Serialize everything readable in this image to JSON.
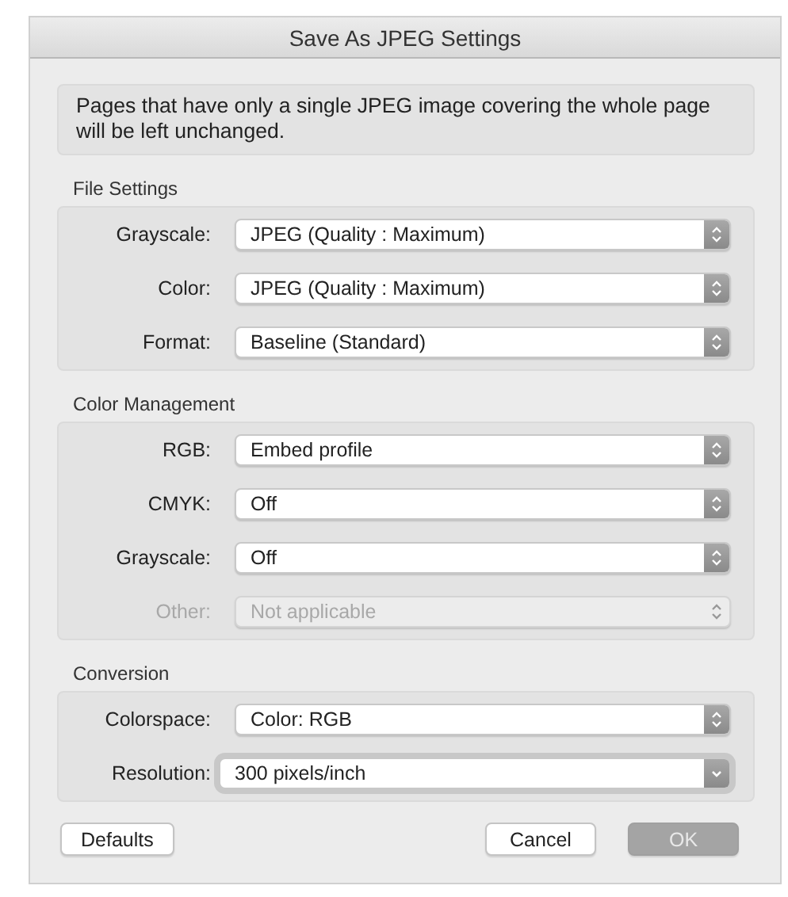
{
  "window": {
    "title": "Save As JPEG Settings"
  },
  "notice": "Pages that have only a single JPEG image covering the whole page will be left unchanged.",
  "sections": [
    {
      "title": "File Settings",
      "rows": [
        {
          "label": "Grayscale:",
          "value": "JPEG (Quality : Maximum)",
          "kind": "popup",
          "disabled": false
        },
        {
          "label": "Color:",
          "value": "JPEG (Quality : Maximum)",
          "kind": "popup",
          "disabled": false
        },
        {
          "label": "Format:",
          "value": "Baseline (Standard)",
          "kind": "popup",
          "disabled": false
        }
      ]
    },
    {
      "title": "Color Management",
      "rows": [
        {
          "label": "RGB:",
          "value": "Embed profile",
          "kind": "popup",
          "disabled": false
        },
        {
          "label": "CMYK:",
          "value": "Off",
          "kind": "popup",
          "disabled": false
        },
        {
          "label": "Grayscale:",
          "value": "Off",
          "kind": "popup",
          "disabled": false
        },
        {
          "label": "Other:",
          "value": "Not applicable",
          "kind": "popup",
          "disabled": true
        }
      ]
    },
    {
      "title": "Conversion",
      "rows": [
        {
          "label": "Colorspace:",
          "value": "Color: RGB",
          "kind": "popup",
          "disabled": false
        },
        {
          "label": "Resolution:",
          "value": "300 pixels/inch",
          "kind": "combo",
          "disabled": false
        }
      ]
    }
  ],
  "left_buttons": [
    {
      "label": "Defaults",
      "disabled": false
    }
  ],
  "right_buttons": [
    {
      "label": "Cancel",
      "disabled": false
    },
    {
      "label": "OK",
      "disabled": true
    }
  ]
}
